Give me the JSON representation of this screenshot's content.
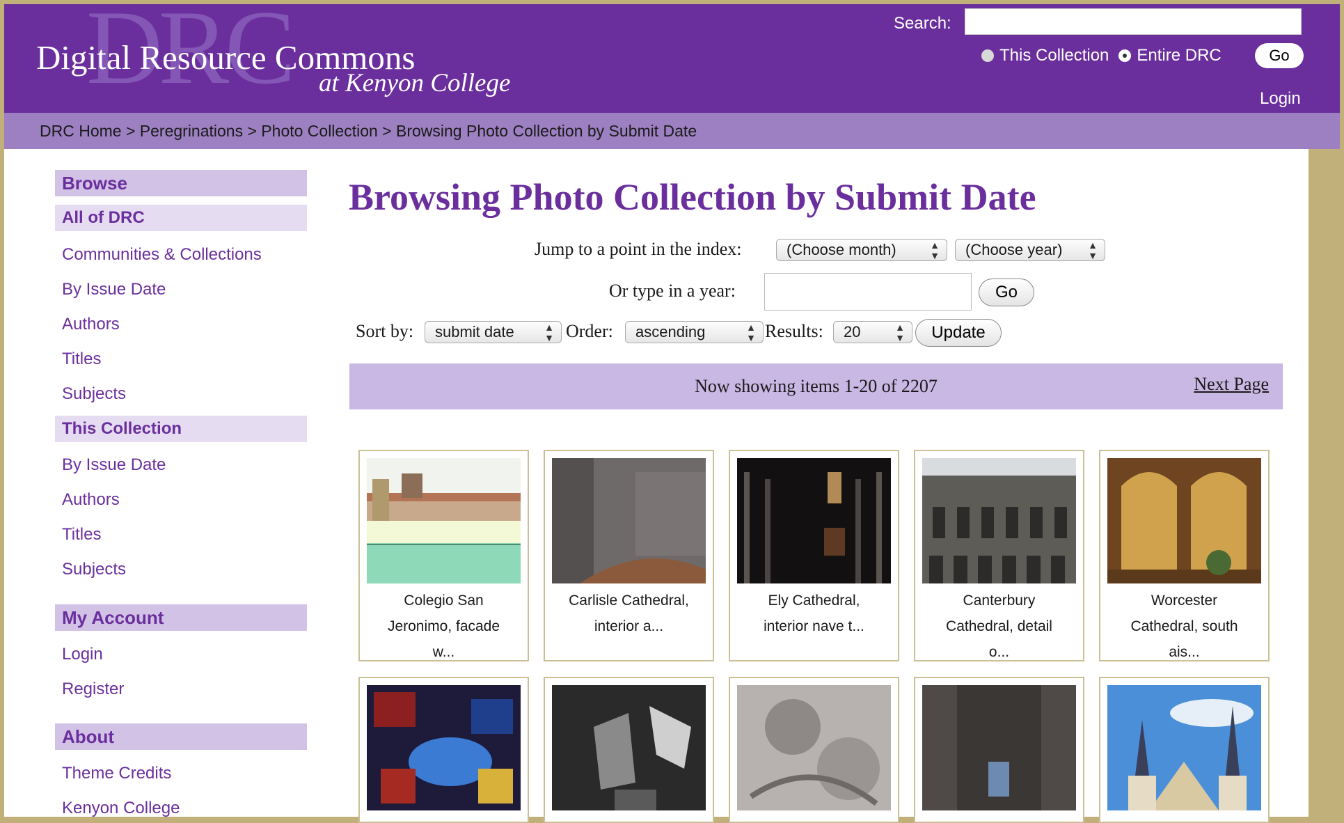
{
  "header": {
    "watermark": "DRC",
    "title": "Digital Resource Commons",
    "subtitle": "at Kenyon College",
    "search_label": "Search:",
    "scope_options": [
      "This Collection",
      "Entire DRC"
    ],
    "scope_selected": "Entire DRC",
    "go_label": "Go",
    "login_label": "Login"
  },
  "breadcrumb": {
    "text": "DRC Home > Peregrinations > Photo Collection > Browsing Photo Collection by Submit Date"
  },
  "sidebar": {
    "browse_title": "Browse",
    "all_drc_title": "All of DRC",
    "all_drc_links": [
      "Communities & Collections",
      "By Issue Date",
      "Authors",
      "Titles",
      "Subjects"
    ],
    "this_collection_title": "This Collection",
    "this_collection_links": [
      "By Issue Date",
      "Authors",
      "Titles",
      "Subjects"
    ],
    "my_account_title": "My Account",
    "my_account_links": [
      "Login",
      "Register"
    ],
    "about_title": "About",
    "about_links": [
      "Theme Credits",
      "Kenyon College"
    ]
  },
  "main": {
    "title": "Browsing Photo Collection by Submit Date",
    "jump_label": "Jump to a point in the index:",
    "month_select": "(Choose month)",
    "year_select": "(Choose year)",
    "type_year_label": "Or type in a year:",
    "go_label": "Go",
    "sort_label": "Sort by:",
    "sort_value": "submit date",
    "order_label": "Order:",
    "order_value": "ascending",
    "results_label": "Results:",
    "results_value": "20",
    "update_label": "Update",
    "status_text": "Now showing items 1-20 of 2207",
    "next_page": "Next Page"
  },
  "items": [
    {
      "caption": [
        "Colegio San",
        "Jeronimo, facade",
        "w..."
      ],
      "thumb": "facade"
    },
    {
      "caption": [
        "Carlisle Cathedral,",
        "interior a..."
      ],
      "thumb": "stone"
    },
    {
      "caption": [
        "Ely Cathedral,",
        "interior nave t..."
      ],
      "thumb": "nave"
    },
    {
      "caption": [
        "Canterbury",
        "Cathedral, detail",
        "o..."
      ],
      "thumb": "arches"
    },
    {
      "caption": [
        "Worcester",
        "Cathedral, south",
        "ais..."
      ],
      "thumb": "warm"
    },
    {
      "caption": [],
      "thumb": "glass"
    },
    {
      "caption": [],
      "thumb": "bw"
    },
    {
      "caption": [],
      "thumb": "carving"
    },
    {
      "caption": [],
      "thumb": "interior"
    },
    {
      "caption": [],
      "thumb": "spires"
    }
  ],
  "colors": {
    "brand_purple": "#6a2f9d",
    "breadcrumb_bg": "#9d80c1",
    "status_bg": "#c9b7e4",
    "page_bg": "#c2b07a"
  }
}
